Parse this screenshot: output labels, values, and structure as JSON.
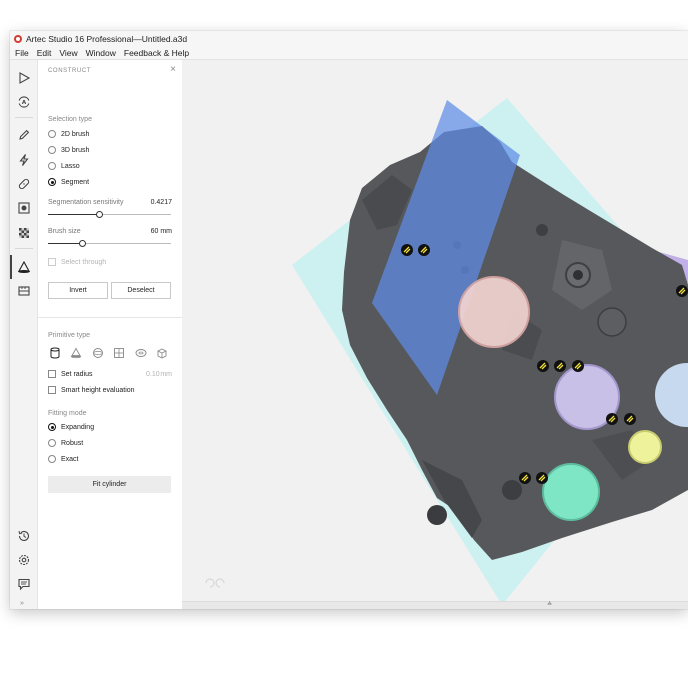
{
  "window": {
    "title": "Artec Studio 16 Professional—Untitled.a3d"
  },
  "menu": [
    "File",
    "Edit",
    "View",
    "Window",
    "Feedback & Help"
  ],
  "toolbar": {
    "items": [
      "play-icon",
      "autopilot-icon",
      "pencil-icon",
      "lightning-icon",
      "bandage-icon",
      "texture-icon",
      "checkerboard-icon",
      "construct-icon",
      "measure-icon"
    ],
    "bottom_items": [
      "history-icon",
      "settings-icon",
      "chat-icon"
    ],
    "active": "construct-icon"
  },
  "panel": {
    "header": "CONSTRUCT",
    "selection_type": {
      "label": "Selection type",
      "options": [
        "2D brush",
        "3D brush",
        "Lasso",
        "Segment"
      ],
      "selected": "Segment"
    },
    "segmentation_sensitivity": {
      "label": "Segmentation sensitivity",
      "value": "0.4217",
      "fraction": 0.4217
    },
    "brush_size": {
      "label": "Brush size",
      "value": "60 mm",
      "fraction": 0.28
    },
    "select_through": {
      "label": "Select through",
      "checked": false,
      "disabled": true
    },
    "invert_label": "Invert",
    "deselect_label": "Deselect",
    "primitive_type": {
      "label": "Primitive type",
      "icons": [
        "cylinder-icon",
        "cone-icon",
        "sphere-icon",
        "plane-icon",
        "torus-icon",
        "box-icon"
      ],
      "selected": "cylinder-icon"
    },
    "set_radius": {
      "label": "Set radius",
      "value": "0.10",
      "unit": "mm",
      "checked": false
    },
    "smart_height": {
      "label": "Smart height evaluation",
      "checked": false
    },
    "fitting_mode": {
      "label": "Fitting mode",
      "options": [
        "Expanding",
        "Robust",
        "Exact"
      ],
      "selected": "Expanding"
    },
    "fit_button_label": "Fit cylinder"
  },
  "colors": {
    "accent": "#222222",
    "plane_cyan": "#c9f1f0",
    "plane_blue": "#5e8ee8",
    "plane_purple": "#b9a3e6",
    "part_gray": "#57585b",
    "fit_green": "#7ee6c4",
    "fit_pink": "#f3d4d2",
    "fit_lavender": "#cfc6ee",
    "fit_yellow": "#eef29a",
    "fit_lightblue": "#cde0f7"
  }
}
